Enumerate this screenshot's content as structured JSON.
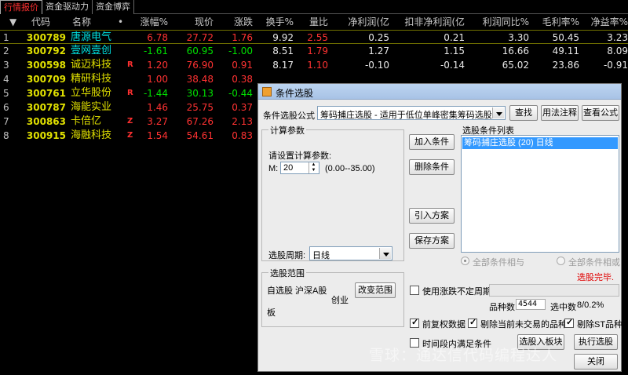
{
  "tabs": [
    "行情报价",
    "资金驱动力",
    "资金博弈"
  ],
  "table": {
    "headers": {
      "sort_mark": "▼",
      "code": "代码",
      "name": "名称",
      "dot": "•",
      "change_pct": "涨幅%",
      "price": "现价",
      "change": "涨跌",
      "turnover": "换手%",
      "volume_ratio": "量比",
      "net_profit": "净利润(亿",
      "deducted_profit": "扣非净利润(亿",
      "profit_yoy": "利润同比%",
      "gross_margin": "毛利率%",
      "pe": "净益率%"
    },
    "rows": [
      {
        "idx": "1",
        "code": "300789",
        "name": "唐源电气",
        "flag": "",
        "chg_pct": "6.78",
        "price": "27.72",
        "chg": "1.76",
        "turn": "9.92",
        "vr": "2.55",
        "np": "0.25",
        "dnp": "0.21",
        "yoy": "3.30",
        "gm": "50.45",
        "pe": "3.23",
        "name_color": "cyan",
        "dir": "up",
        "vr_dir": "up"
      },
      {
        "idx": "2",
        "code": "300792",
        "name": "壹网壹创",
        "flag": "",
        "chg_pct": "-1.61",
        "price": "60.95",
        "chg": "-1.00",
        "turn": "8.51",
        "vr": "1.79",
        "np": "1.27",
        "dnp": "1.15",
        "yoy": "16.66",
        "gm": "49.11",
        "pe": "8.09",
        "name_color": "cyan",
        "dir": "down",
        "vr_dir": "up"
      },
      {
        "idx": "3",
        "code": "300598",
        "name": "诚迈科技",
        "flag": "R",
        "chg_pct": "1.20",
        "price": "76.90",
        "chg": "0.91",
        "turn": "8.17",
        "vr": "1.10",
        "np": "-0.10",
        "dnp": "-0.14",
        "yoy": "65.02",
        "gm": "23.86",
        "pe": "-0.91",
        "name_color": "yellow",
        "dir": "up",
        "vr_dir": "up"
      },
      {
        "idx": "4",
        "code": "300709",
        "name": "精研科技",
        "flag": "",
        "chg_pct": "1.00",
        "price": "38.48",
        "chg": "0.38",
        "turn": "",
        "vr": "",
        "np": "",
        "dnp": "",
        "yoy": "",
        "gm": "",
        "pe": "",
        "name_color": "yellow",
        "dir": "up",
        "vr_dir": "up"
      },
      {
        "idx": "5",
        "code": "300761",
        "name": "立华股份",
        "flag": "R",
        "chg_pct": "-1.44",
        "price": "30.13",
        "chg": "-0.44",
        "turn": "",
        "vr": "",
        "np": "",
        "dnp": "",
        "yoy": "",
        "gm": "",
        "pe": "",
        "name_color": "yellow",
        "dir": "down",
        "vr_dir": "up"
      },
      {
        "idx": "6",
        "code": "300787",
        "name": "海能实业",
        "flag": "",
        "chg_pct": "1.46",
        "price": "25.75",
        "chg": "0.37",
        "turn": "",
        "vr": "",
        "np": "",
        "dnp": "",
        "yoy": "",
        "gm": "",
        "pe": "",
        "name_color": "yellow",
        "dir": "up",
        "vr_dir": "up"
      },
      {
        "idx": "7",
        "code": "300863",
        "name": "卡倍亿",
        "flag": "Z",
        "chg_pct": "3.27",
        "price": "67.26",
        "chg": "2.13",
        "turn": "",
        "vr": "",
        "np": "",
        "dnp": "",
        "yoy": "",
        "gm": "",
        "pe": "",
        "name_color": "yellow",
        "dir": "up",
        "vr_dir": "up"
      },
      {
        "idx": "8",
        "code": "300915",
        "name": "海融科技",
        "flag": "Z",
        "chg_pct": "1.54",
        "price": "54.61",
        "chg": "0.83",
        "turn": "",
        "vr": "",
        "np": "",
        "dnp": "",
        "yoy": "",
        "gm": "",
        "pe": "",
        "name_color": "yellow",
        "dir": "up",
        "vr_dir": "up"
      }
    ]
  },
  "dialog": {
    "title": "条件选股",
    "formula_label": "条件选股公式",
    "formula_value": "筹码捕庄选股 - 适用于低位单峰密集筹码选股",
    "btn_find": "查找",
    "btn_usage": "用法注释",
    "btn_view_formula": "查看公式",
    "calc_group": "计算参数",
    "calc_prompt": "请设置计算参数:",
    "param_label": "M:",
    "param_value": "20",
    "param_range": "(0.00--35.00)",
    "period_label": "选股周期:",
    "period_value": "日线",
    "btn_add": "加入条件",
    "btn_delete": "删除条件",
    "btn_import": "引入方案",
    "btn_save": "保存方案",
    "cond_list_label": "选股条件列表",
    "cond_items": [
      "筹码捕庄选股 (20) 日线"
    ],
    "radio_and": "全部条件相与",
    "radio_or": "全部条件相或",
    "status": "选股完毕.",
    "range_group": "选股范围",
    "range_items": [
      "自选股",
      "沪深A股",
      "创业板"
    ],
    "btn_change_range": "改变范围",
    "use_uncertain_period": "使用涨跌不定周期",
    "count_label": "品种数",
    "count_value": "4544",
    "selected_label": "选中数",
    "selected_value": "8/0.2%",
    "opt_prev_adjust": "前复权数据",
    "opt_exclude_untraded": "剔除当前未交易的品种",
    "opt_exclude_st": "剔除ST品种",
    "opt_time_range": "时间段内满足条件",
    "btn_to_block": "选股入板块",
    "btn_execute": "执行选股",
    "btn_close": "关闭"
  },
  "watermark": "雪球：通达信代码编程达人",
  "colors": {
    "up": "#ff3232",
    "down": "#00e000",
    "code": "#e0e000",
    "selection": "#3399ff"
  }
}
